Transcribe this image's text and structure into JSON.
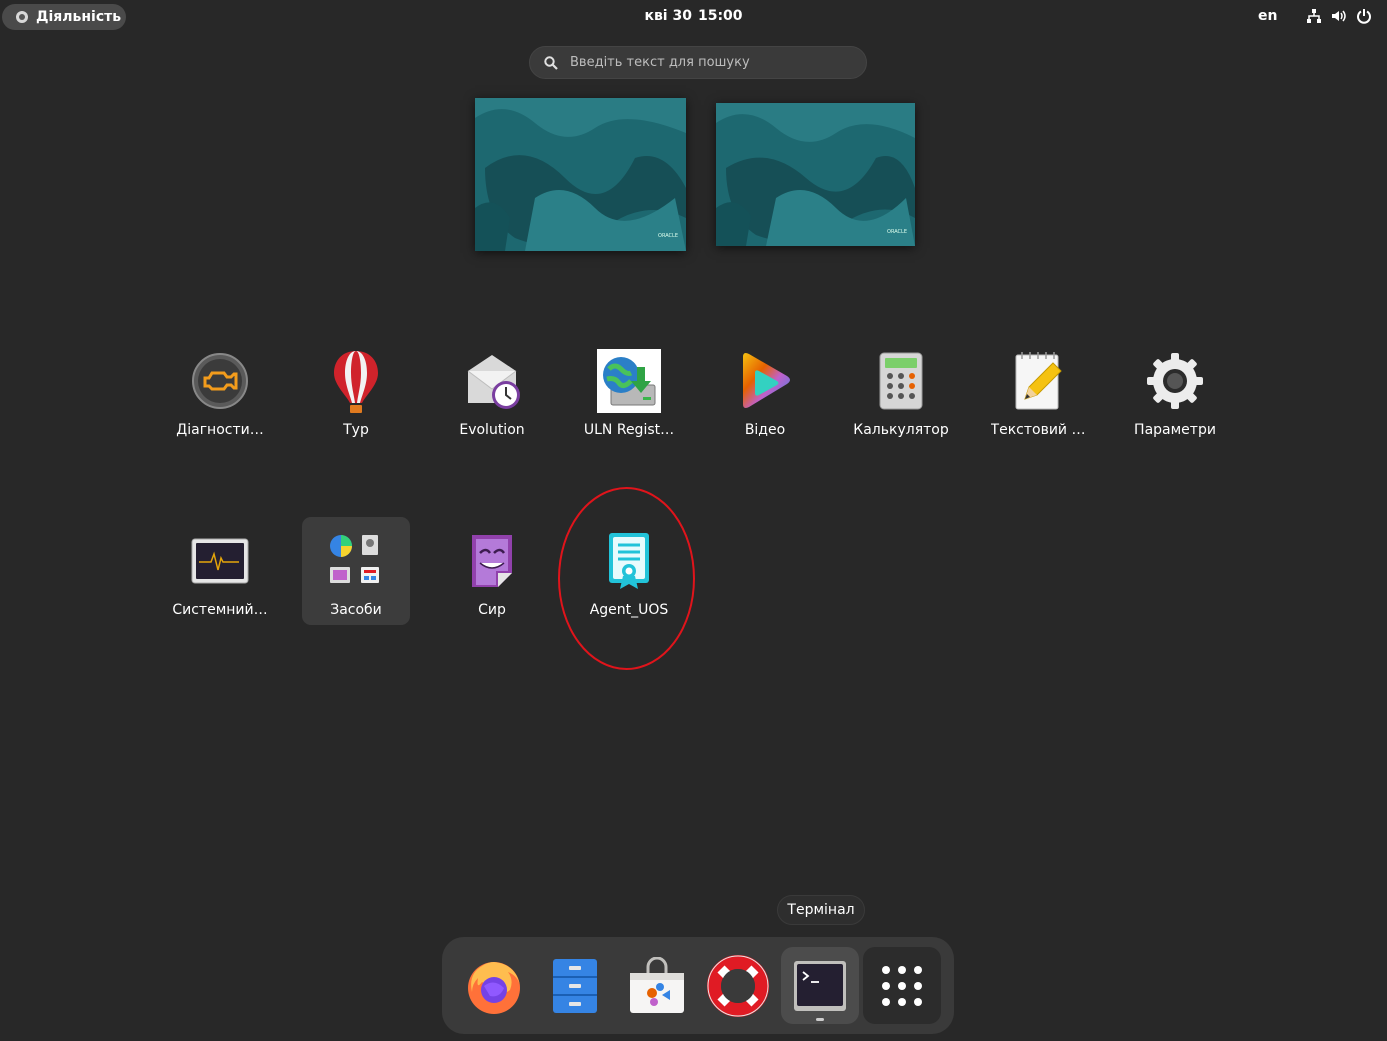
{
  "topbar": {
    "activities_label": "Діяльність",
    "date": "кві 30",
    "time": "15:00",
    "language": "en",
    "icons": [
      "network-icon",
      "volume-icon",
      "power-icon"
    ]
  },
  "search": {
    "placeholder": "Введіть текст для пошуку",
    "value": ""
  },
  "workspaces": [
    {
      "name": "workspace-1",
      "wallpaper_mark": "ORACLE"
    },
    {
      "name": "workspace-2",
      "wallpaper_mark": "ORACLE"
    }
  ],
  "apps": [
    {
      "label": "Діагности…",
      "icon": "diagnostics-icon"
    },
    {
      "label": "Тур",
      "icon": "tour-balloon-icon"
    },
    {
      "label": "Evolution",
      "icon": "evolution-mail-icon"
    },
    {
      "label": "ULN Regist…",
      "icon": "uln-registration-icon"
    },
    {
      "label": "Відео",
      "icon": "video-player-icon"
    },
    {
      "label": "Калькулятор",
      "icon": "calculator-icon"
    },
    {
      "label": "Текстовий …",
      "icon": "text-editor-icon"
    },
    {
      "label": "Параметри",
      "icon": "settings-gear-icon"
    },
    {
      "label": "Системний…",
      "icon": "system-monitor-icon"
    },
    {
      "label": "Засоби",
      "icon": "utilities-folder-icon"
    },
    {
      "label": "Сир",
      "icon": "cheese-icon"
    },
    {
      "label": "Agent_UOS",
      "icon": "agent-certificate-icon"
    }
  ],
  "tooltip": "Термінал",
  "dock": [
    {
      "name": "firefox",
      "icon": "firefox-icon"
    },
    {
      "name": "files",
      "icon": "file-cabinet-icon"
    },
    {
      "name": "software",
      "icon": "software-store-icon"
    },
    {
      "name": "help",
      "icon": "lifebuoy-icon"
    },
    {
      "name": "terminal",
      "icon": "terminal-icon",
      "active": true
    },
    {
      "name": "show-apps",
      "icon": "app-grid-icon"
    }
  ],
  "colors": {
    "background": "#282828",
    "highlight_circle": "#e0141b",
    "accent_teal": "#1e6a72"
  }
}
